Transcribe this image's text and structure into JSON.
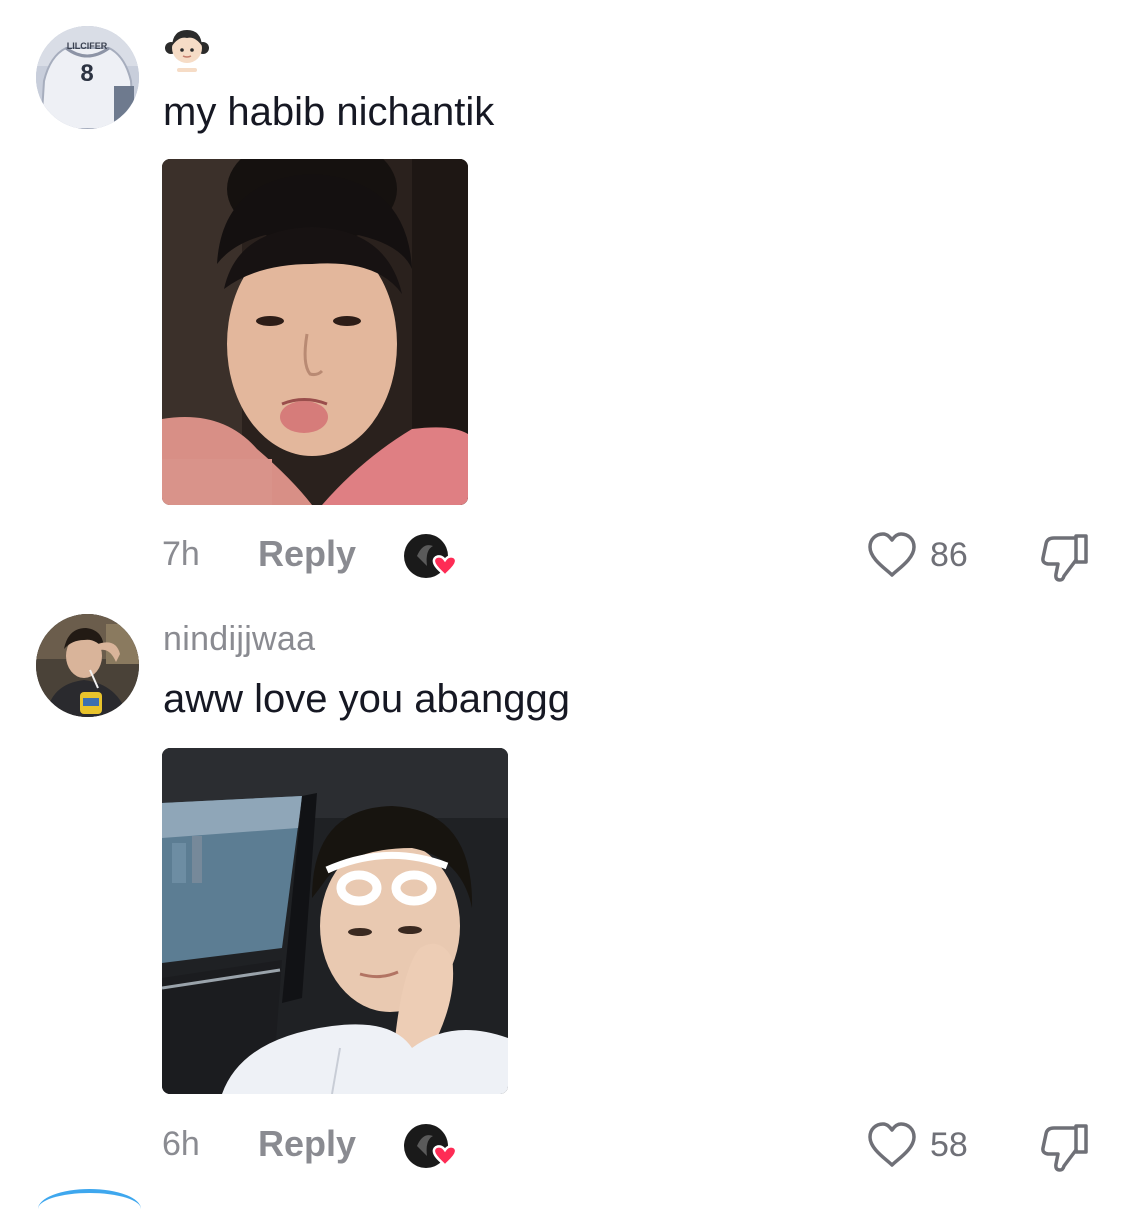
{
  "comments": [
    {
      "username": "",
      "avatar": "jersey-avatar",
      "avatar_jersey_name": "LILCIFER",
      "avatar_jersey_number": "8",
      "name_icon": "girl-emoji-icon",
      "text": "my habib nichantik",
      "photo": "selfie-pink-shirt-photo",
      "time": "7h",
      "reply_label": "Reply",
      "creator_liked": true,
      "like_icon": "heart-outline-icon",
      "likes": "86",
      "dislike_icon": "thumbs-down-icon"
    },
    {
      "username": "nindijjwaa",
      "avatar": "profile-avatar",
      "text": "aww love you abanggg",
      "photo": "car-selfie-photo",
      "time": "6h",
      "reply_label": "Reply",
      "creator_liked": true,
      "like_icon": "heart-outline-icon",
      "likes": "58",
      "dislike_icon": "thumbs-down-icon"
    }
  ],
  "colors": {
    "text": "#161823",
    "muted": "#8a8b91",
    "creator_heart": "#fe2c55"
  }
}
